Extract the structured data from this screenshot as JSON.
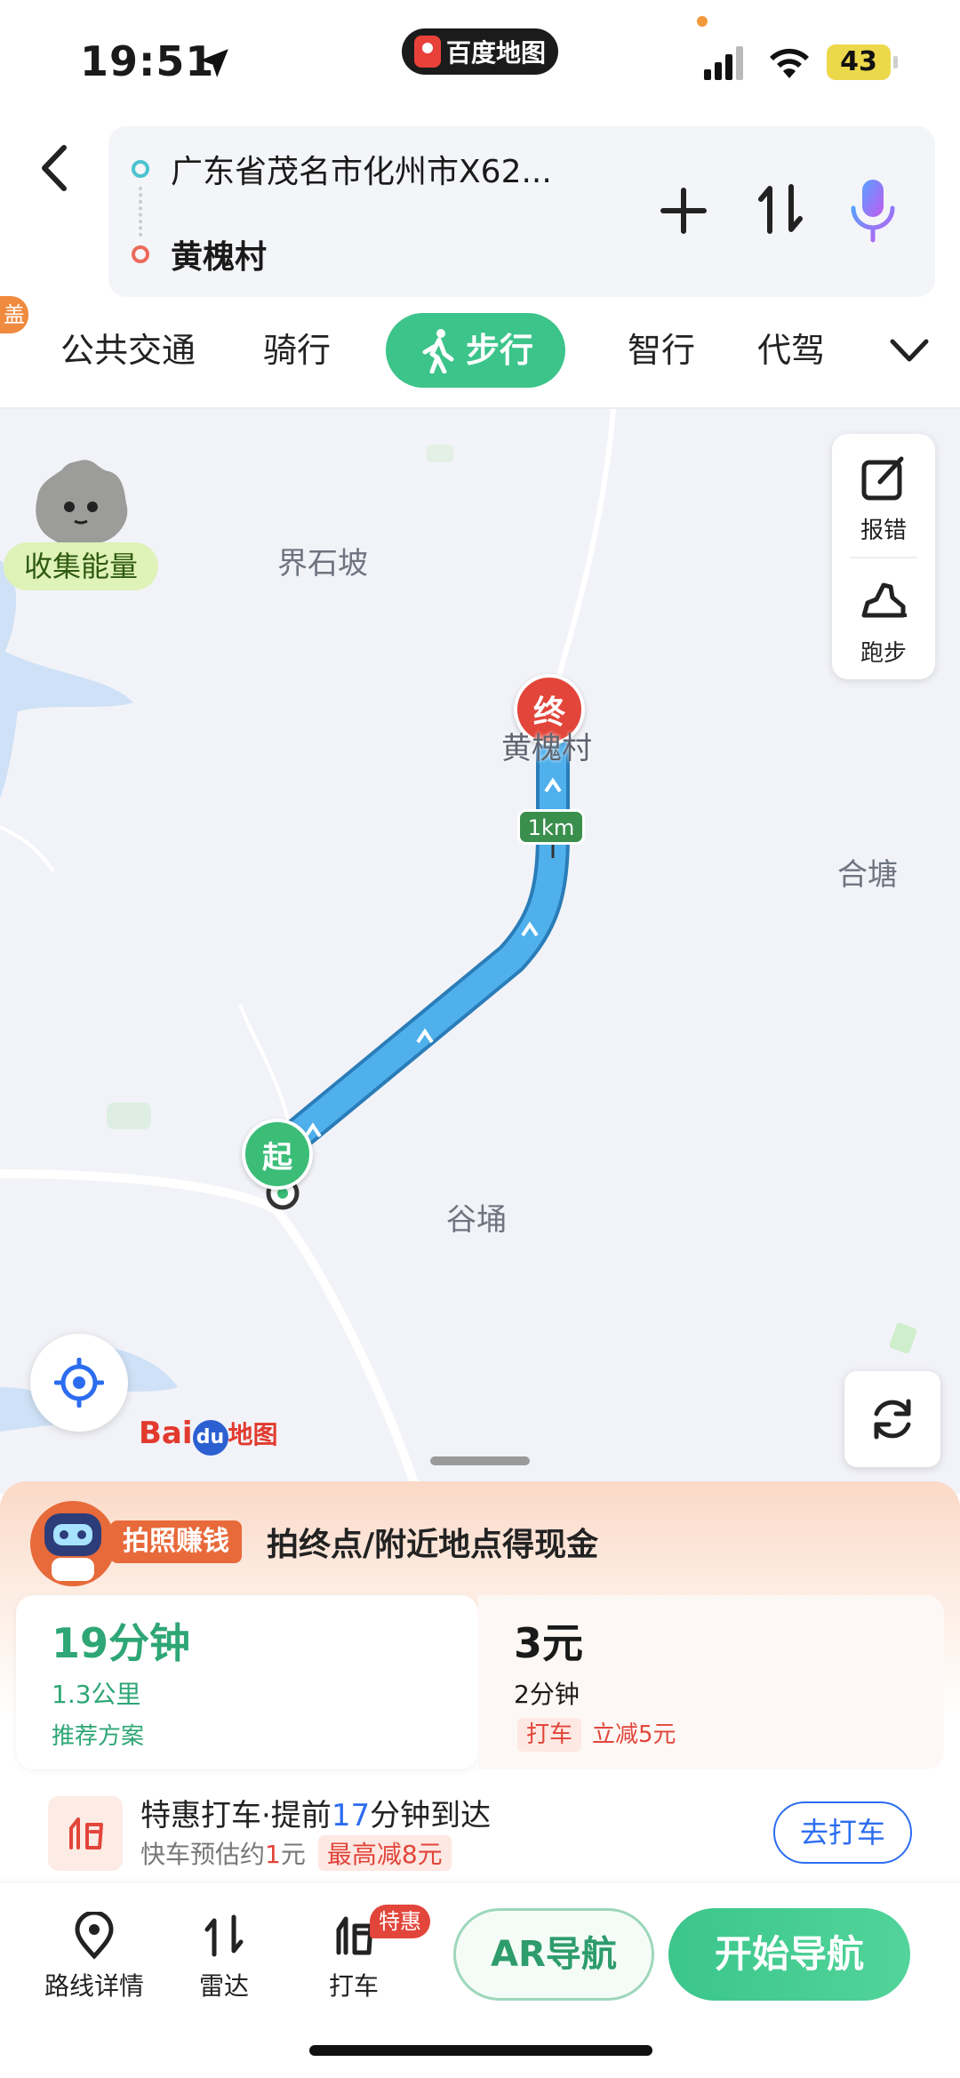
{
  "status_bar": {
    "time": "19:51",
    "app_label": "百度地图",
    "battery": "43"
  },
  "header": {
    "from": "广东省茂名市化州市X62...",
    "to": "黄槐村"
  },
  "corner_tag": "盖",
  "modes": {
    "tabs": [
      "公共交通",
      "骑行",
      "步行",
      "智行",
      "代驾"
    ],
    "active": "步行"
  },
  "map": {
    "energy_label": "收集能量",
    "places": [
      "界石坡",
      "合塘",
      "谷埇"
    ],
    "end_marker": "终",
    "end_label": "黄槐村",
    "start_marker": "起",
    "distance_tag": "1km",
    "tools": {
      "report": "报错",
      "run": "跑步"
    },
    "logo": {
      "bai": "Bai",
      "du": "du",
      "suffix": "地图"
    }
  },
  "promo": {
    "tag": "拍照赚钱",
    "text": "拍终点/附近地点得现金"
  },
  "options": {
    "walk": {
      "time": "19分钟",
      "distance": "1.3公里",
      "note": "推荐方案"
    },
    "taxi": {
      "price": "3元",
      "time": "2分钟",
      "chip": "打车",
      "discount": "立减5元"
    }
  },
  "taxi_offer": {
    "title_pre": "特惠打车·提前",
    "title_num": "17",
    "title_post": "分钟到达",
    "sub_pre": "快车预估约",
    "sub_num": "1",
    "sub_post": "元",
    "sub_chip": "最高减8元",
    "button": "去打车"
  },
  "bottom_bar": {
    "route_detail": "路线详情",
    "radar": "雷达",
    "taxi": "打车",
    "taxi_badge": "特惠",
    "ar_nav": "AR导航",
    "start_nav": "开始导航"
  },
  "colors": {
    "accent_green": "#3cc48a",
    "route_blue": "#4aa8e8",
    "end_red": "#e2453a",
    "link_blue": "#2c6df0"
  }
}
